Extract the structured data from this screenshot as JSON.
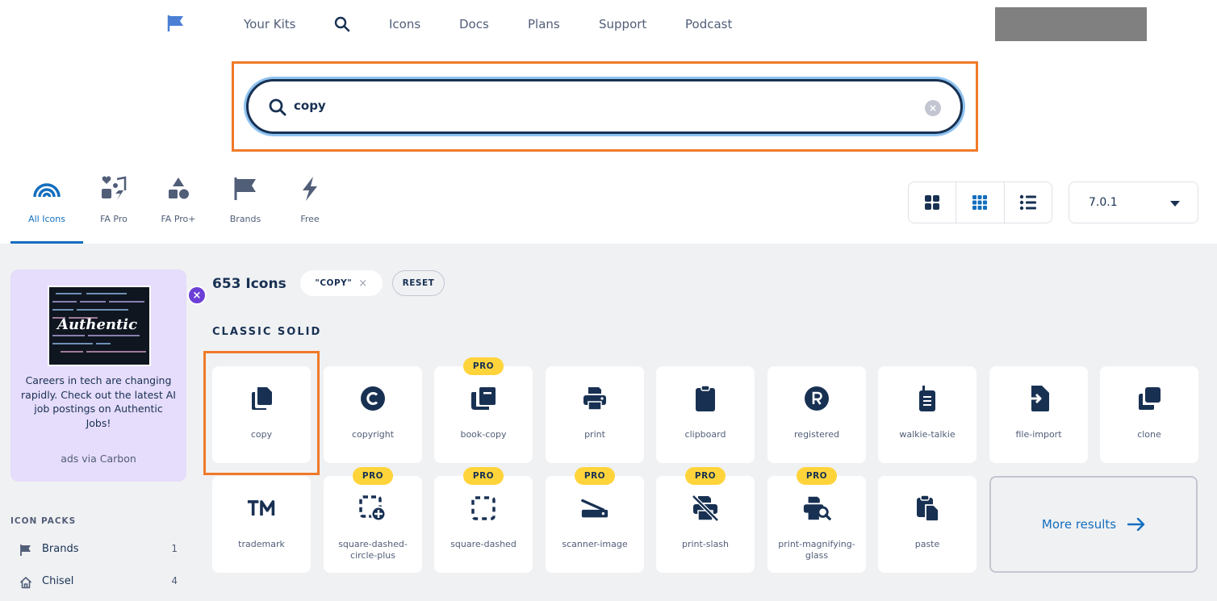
{
  "nav": {
    "links": [
      "Your Kits",
      "Icons",
      "Docs",
      "Plans",
      "Support",
      "Podcast"
    ]
  },
  "search": {
    "value": "copy",
    "clear_label": "×"
  },
  "family_tabs": [
    {
      "label": "All Icons",
      "icon": "rainbow-icon",
      "active": true
    },
    {
      "label": "FA Pro",
      "icon": "icons-icon",
      "active": false
    },
    {
      "label": "FA Pro+",
      "icon": "shapes-icon",
      "active": false
    },
    {
      "label": "Brands",
      "icon": "flag-icon",
      "active": false
    },
    {
      "label": "Free",
      "icon": "bolt-icon",
      "active": false
    }
  ],
  "view_modes": [
    "grid-large-icon",
    "grid-small-icon",
    "list-icon"
  ],
  "version": {
    "label": "7.0.1"
  },
  "ad": {
    "brand": "Authentic",
    "text": "Careers in tech are changing rapidly. Check out the latest AI job postings on Authentic Jobs!",
    "via": "ads via Carbon",
    "close_label": "×"
  },
  "icon_packs": {
    "title": "ICON PACKS",
    "items": [
      {
        "label": "Brands",
        "count": "1",
        "icon": "flag-icon"
      },
      {
        "label": "Chisel",
        "count": "4",
        "icon": "house-icon"
      }
    ]
  },
  "results": {
    "count": "653 Icons",
    "filter_chip": "\"COPY\"",
    "chip_close": "×",
    "reset_label": "RESET",
    "section_title": "CLASSIC SOLID",
    "pro_label": "PRO",
    "more_label": "More results"
  },
  "icons": [
    {
      "name": "copy",
      "pro": false
    },
    {
      "name": "copyright",
      "pro": false
    },
    {
      "name": "book-copy",
      "pro": true
    },
    {
      "name": "print",
      "pro": false
    },
    {
      "name": "clipboard",
      "pro": false
    },
    {
      "name": "registered",
      "pro": false
    },
    {
      "name": "walkie-talkie",
      "pro": false
    },
    {
      "name": "file-import",
      "pro": false
    },
    {
      "name": "clone",
      "pro": false
    },
    {
      "name": "trademark",
      "pro": false
    },
    {
      "name": "square-dashed-circle-plus",
      "pro": true
    },
    {
      "name": "square-dashed",
      "pro": true
    },
    {
      "name": "scanner-image",
      "pro": true
    },
    {
      "name": "print-slash",
      "pro": true
    },
    {
      "name": "print-magnifying-glass",
      "pro": true
    },
    {
      "name": "paste",
      "pro": false
    }
  ],
  "colors": {
    "navy": "#183153",
    "accent_blue": "#146ebe",
    "highlight_orange": "#f07a28",
    "pro_yellow": "#ffd43b",
    "ad_purple": "#e6dcfb"
  }
}
